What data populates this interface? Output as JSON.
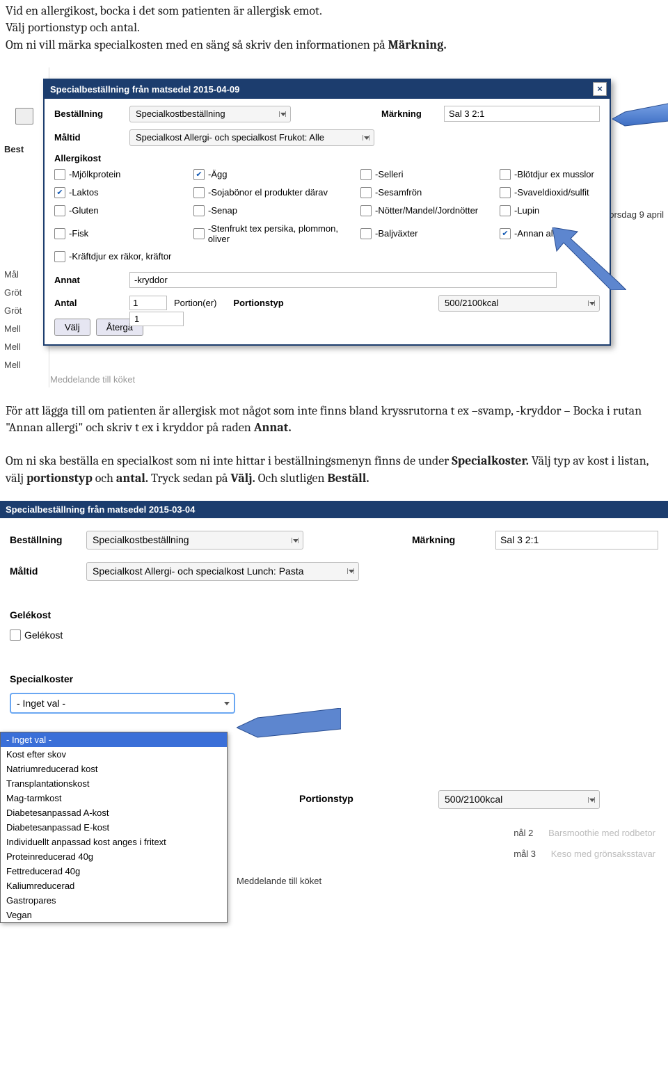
{
  "intro1_p1": "Vid en allergikost, bocka i det som patienten är allergisk emot.",
  "intro1_p2": "Välj portionstyp och antal.",
  "intro1_p3a": "Om ni vill märka specialkosten med en säng så skriv den informationen på ",
  "intro1_p3b": "Märkning.",
  "d1": {
    "title": "Specialbeställning från matsedel 2015-04-09",
    "best": "Beställning",
    "best_val": "Specialkostbeställning",
    "mark": "Märkning",
    "mark_val": "Sal 3 2:1",
    "maltid": "Måltid",
    "maltid_val": "Specialkost Allergi- och specialkost Frukot: Alle",
    "allergi_h": "Allergikost",
    "checks": [
      {
        "label": "-Mjölkprotein",
        "c": false
      },
      {
        "label": "-Ägg",
        "c": true
      },
      {
        "label": "-Selleri",
        "c": false
      },
      {
        "label": "-Blötdjur ex musslor",
        "c": false
      },
      {
        "label": "-Laktos",
        "c": true
      },
      {
        "label": "-Sojabönor el produkter därav",
        "c": false
      },
      {
        "label": "-Sesamfrön",
        "c": false
      },
      {
        "label": "-Svaveldioxid/sulfit",
        "c": false
      },
      {
        "label": "-Gluten",
        "c": false
      },
      {
        "label": "-Senap",
        "c": false
      },
      {
        "label": "-Nötter/Mandel/Jordnötter",
        "c": false
      },
      {
        "label": "-Lupin",
        "c": false
      },
      {
        "label": "-Fisk",
        "c": false
      },
      {
        "label": "-Stenfrukt tex persika, plommon, oliver",
        "c": false
      },
      {
        "label": "-Baljväxter",
        "c": false
      },
      {
        "label": "-Annan allergi",
        "c": true
      },
      {
        "label": "-Kräftdjur ex räkor, kräftor",
        "c": false
      }
    ],
    "annat": "Annat",
    "annat_val": "-kryddor",
    "antal": "Antal",
    "antal_val": "1",
    "portion_lbl": "Portion(er)",
    "ptype": "Portionstyp",
    "ptype_val": "500/2100kcal",
    "valj": "Välj",
    "aterga": "Återgå",
    "dropdown_val": "1"
  },
  "left": {
    "best": "Best",
    "mal": "Mål",
    "grot1": "Gröt",
    "grot2": "Gröt",
    "mell1": "Mell",
    "mell2": "Mell",
    "mell3": "Mell",
    "medd": "Meddelande till köket"
  },
  "right_day": "orsdag 9 april",
  "intro2_a": "För att lägga till om patienten är allergisk mot något som inte finns bland kryssrutorna t ex –svamp, -kryddor – Bocka i rutan \"Annan allergi\" och skriv t ex i kryddor på raden ",
  "intro2_b": "Annat.",
  "intro3_a": "Om ni ska beställa en specialkost som ni inte hittar i beställningsmenyn finns de under ",
  "intro3_b": "Specialkoster.",
  "intro3_c": " Välj typ av kost i listan, välj ",
  "intro3_d": "portionstyp",
  "intro3_e": " och ",
  "intro3_f": "antal.",
  "intro3_g": " Tryck sedan på ",
  "intro3_h": "Välj.",
  "intro3_i": " Och slutligen ",
  "intro3_j": "Beställ.",
  "d2": {
    "title": "Specialbeställning från matsedel 2015-03-04",
    "best": "Beställning",
    "best_val": "Specialkostbeställning",
    "mark": "Märkning",
    "mark_val": "Sal 3 2:1",
    "maltid": "Måltid",
    "maltid_val": "Specialkost Allergi- och specialkost Lunch: Pasta",
    "gele_h": "Gelékost",
    "gele_chk": "Gelékost",
    "spec_h": "Specialkoster",
    "sp_sel": "- Inget val -",
    "options": [
      "- Inget val -",
      "Kost efter skov",
      "Natriumreducerad kost",
      "Transplantationskost",
      "Mag-tarmkost",
      "Diabetesanpassad A-kost",
      "Diabetesanpassad E-kost",
      "Individuellt anpassad kost anges i fritext",
      "Proteinreducerad 40g",
      "Fettreducerad 40g",
      "Kaliumreducerad",
      "Gastropares",
      "Vegan"
    ],
    "ptype": "Portionstyp",
    "ptype_val": "500/2100kcal",
    "ghost": [
      {
        "l": "nål 2",
        "r": "Barsmoothie med rodbetor"
      },
      {
        "l": "mål 3",
        "r": "Keso med grönsaksstavar"
      }
    ],
    "medd": "Meddelande till köket"
  }
}
